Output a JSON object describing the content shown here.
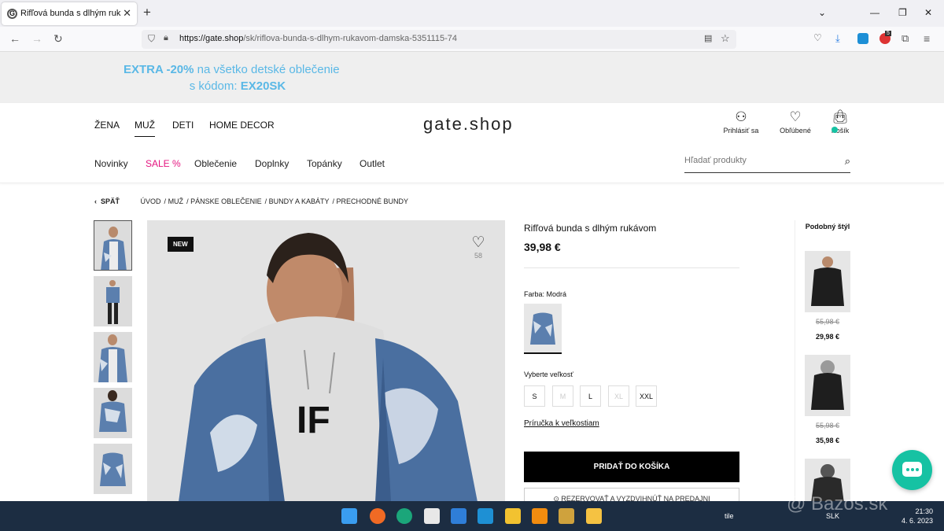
{
  "browser": {
    "tab_title": "Rifľová bunda s dlhým rukávom",
    "url_domain": "https://gate.shop",
    "url_path": "/sk/riflova-bunda-s-dlhym-rukavom-damska-5351115-74",
    "ext_badge": "5"
  },
  "promo": {
    "line1_bold": "EXTRA -20%",
    "line1_rest": " na všetko detské oblečenie",
    "line2_pre": "s kódom: ",
    "line2_code": "EX20SK"
  },
  "header": {
    "gender_nav": [
      "ŽENA",
      "MUŽ",
      "DETI",
      "HOME DECOR"
    ],
    "logo": "gate.shop",
    "login": "Prihlásiť sa",
    "favorites": "Obľúbené",
    "cart": "Košík",
    "category_nav": [
      "Novinky",
      "SALE %",
      "Oblečenie",
      "Doplnky",
      "Topánky",
      "Outlet"
    ],
    "search_placeholder": "Hľadať produkty",
    "sale_color": "#e4147f"
  },
  "breadcrumb": {
    "back": "SPÄŤ",
    "items": [
      "ÚVOD",
      "MUŽ",
      "PÁNSKE OBLEČENIE",
      "BUNDY A KABÁTY",
      "PRECHODNÉ BUNDY"
    ]
  },
  "gallery": {
    "badge": "NEW",
    "fav_count": "58",
    "print_letters": "IF"
  },
  "product": {
    "name": "Rifľová bunda s dlhým rukávom",
    "price": "39,98 €",
    "color_label": "Farba: Modrá",
    "size_label": "Vyberte veľkosť",
    "sizes": [
      "S",
      "M",
      "L",
      "XL",
      "XXL"
    ],
    "sizes_unavailable": [
      "M",
      "XL"
    ],
    "size_guide": "Príručka k veľkostiam",
    "add_to_cart": "PRIDAŤ DO KOŠÍKA",
    "store_check": "REZERVOVAŤ A VYZDVIHNÚŤ NA PREDAJNI"
  },
  "similar": {
    "title": "Podobný štýl",
    "items": [
      {
        "old_price": "55,98 €",
        "new_price": "29,98 €"
      },
      {
        "old_price": "55,98 €",
        "new_price": "35,98 €"
      }
    ]
  },
  "taskbar": {
    "weather": "tile",
    "lang": "SLK",
    "time": "21:30",
    "date": "4. 6. 2023"
  },
  "watermark": "@ Bazos.sk",
  "colors": {
    "accent": "#16c2a3",
    "promo": "#5ab8e6",
    "denim": "#4a6fa0"
  }
}
